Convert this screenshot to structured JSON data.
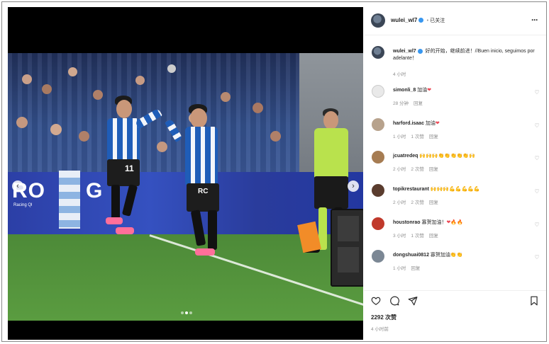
{
  "header": {
    "username": "wulei_wl7",
    "separator": "•",
    "follow_status": "已关注",
    "more": "···"
  },
  "caption": {
    "username": "wulei_wl7",
    "text": "好的开始，继续前进！//Buen inicio, seguimos por adelante！",
    "time": "4 小时"
  },
  "comments": [
    {
      "username": "simonli_8",
      "text": "加油",
      "emoji": "❤",
      "meta": [
        "28 分钟",
        "回复"
      ],
      "avatar_color": "#e9e9e9"
    },
    {
      "username": "harford.isaac",
      "text": "加油",
      "emoji": "❤",
      "meta": [
        "1 小时",
        "1 次赞",
        "回复"
      ],
      "avatar_color": "#b7a28c"
    },
    {
      "username": "jcuatredeq",
      "text": "",
      "emoji": "🙌🙌🙌👏👏👏👏👏🙌",
      "meta": [
        "2 小时",
        "2 次赞",
        "回复"
      ],
      "avatar_color": "#a67c52"
    },
    {
      "username": "topikrestaurant",
      "text": "",
      "emoji": "🙌🙌🙌💪💪💪💪💪",
      "meta": [
        "2 小时",
        "2 次赞",
        "回复"
      ],
      "avatar_color": "#5a3c2e"
    },
    {
      "username": "houstonrao",
      "text": "寡贺加油！",
      "emoji": "❤🔥🔥",
      "meta": [
        "3 小时",
        "1 次赞",
        "回复"
      ],
      "avatar_color": "#c0392b"
    },
    {
      "username": "dongshuai0812",
      "text": "寡贺加油",
      "emoji": "👏👏",
      "meta": [
        "1 小时",
        "回复"
      ],
      "avatar_color": "#7b8794"
    }
  ],
  "footer": {
    "likes": "2292 次赞",
    "time": "4 小时前"
  },
  "media": {
    "adboard_left": "RO",
    "adboard_left_small": "Racing Ql",
    "adboard_mid": "G",
    "player_number": "11",
    "player_number_2": "RC"
  },
  "colors": {
    "verified": "#3897f0",
    "heart_red": "#ed4956",
    "team_blue": "#1f5db8",
    "referee_yellow": "#b9e24d"
  },
  "icons": [
    "heart-icon",
    "comment-icon",
    "share-icon",
    "bookmark-icon",
    "more-icon",
    "verified-icon"
  ]
}
